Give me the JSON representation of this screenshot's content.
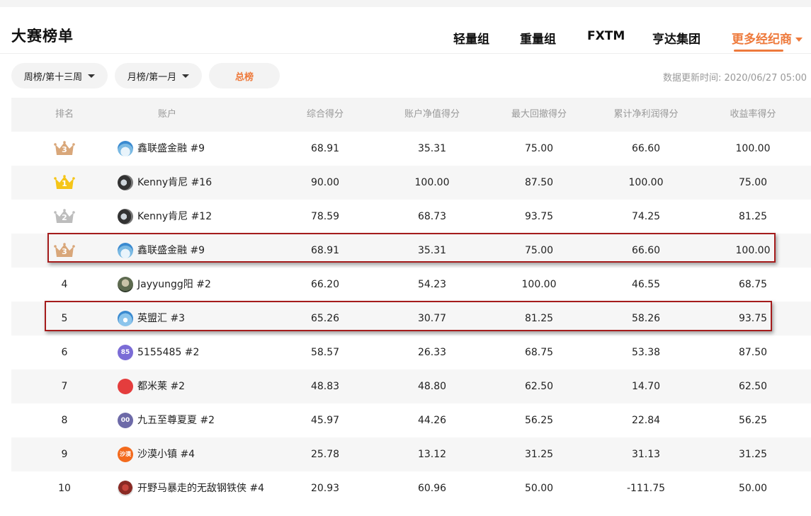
{
  "header": {
    "title": "大赛榜单",
    "tabs": [
      {
        "label": "轻量组",
        "active": false
      },
      {
        "label": "重量组",
        "active": false
      },
      {
        "label": "FXTM",
        "active": false
      },
      {
        "label": "亨达集团",
        "active": false
      },
      {
        "label": "更多经纪商",
        "active": true
      }
    ]
  },
  "filters": {
    "week": "周榜/第十三周",
    "month": "月榜/第一月",
    "total": "总榜",
    "update_time": "数据更新时间: 2020/06/27 05:00"
  },
  "table": {
    "columns": [
      "排名",
      "账户",
      "综合得分",
      "账户净值得分",
      "最大回撤得分",
      "累计净利润得分",
      "收益率得分"
    ],
    "rows": [
      {
        "rank": "3",
        "rank_style": "crown-bronze",
        "avatar": "sky",
        "avatar_text": "",
        "account": "鑫联盛金融 #9",
        "s1": "68.91",
        "s2": "35.31",
        "s3": "75.00",
        "s4": "66.60",
        "s5": "100.00"
      },
      {
        "rank": "1",
        "rank_style": "crown-gold",
        "avatar": "dark",
        "avatar_text": "",
        "account": "Kenny肯尼 #16",
        "s1": "90.00",
        "s2": "100.00",
        "s3": "87.50",
        "s4": "100.00",
        "s5": "75.00"
      },
      {
        "rank": "2",
        "rank_style": "crown-silver",
        "avatar": "dark",
        "avatar_text": "",
        "account": "Kenny肯尼 #12",
        "s1": "78.59",
        "s2": "68.73",
        "s3": "93.75",
        "s4": "74.25",
        "s5": "81.25"
      },
      {
        "rank": "3",
        "rank_style": "crown-bronze",
        "avatar": "sky",
        "avatar_text": "",
        "account": "鑫联盛金融 #9",
        "s1": "68.91",
        "s2": "35.31",
        "s3": "75.00",
        "s4": "66.60",
        "s5": "100.00"
      },
      {
        "rank": "4",
        "rank_style": "text",
        "avatar": "photo",
        "avatar_text": "",
        "account": "Jayyungg阳 #2",
        "s1": "66.20",
        "s2": "54.23",
        "s3": "100.00",
        "s4": "46.55",
        "s5": "68.75"
      },
      {
        "rank": "5",
        "rank_style": "text",
        "avatar": "blue",
        "avatar_text": "",
        "account": "英盟汇 #3",
        "s1": "65.26",
        "s2": "30.77",
        "s3": "81.25",
        "s4": "58.26",
        "s5": "93.75"
      },
      {
        "rank": "6",
        "rank_style": "text",
        "avatar": "purple",
        "avatar_text": "85",
        "account": "5155485 #2",
        "s1": "58.57",
        "s2": "26.33",
        "s3": "68.75",
        "s4": "53.38",
        "s5": "87.50"
      },
      {
        "rank": "7",
        "rank_style": "text",
        "avatar": "red",
        "avatar_text": "",
        "account": "都米莱 #2",
        "s1": "48.83",
        "s2": "48.80",
        "s3": "62.50",
        "s4": "14.70",
        "s5": "62.50"
      },
      {
        "rank": "8",
        "rank_style": "text",
        "avatar": "indigo",
        "avatar_text": "00",
        "account": "九五至尊夏夏 #2",
        "s1": "45.97",
        "s2": "44.26",
        "s3": "56.25",
        "s4": "22.84",
        "s5": "56.25"
      },
      {
        "rank": "9",
        "rank_style": "text",
        "avatar": "orange",
        "avatar_text": "沙漠",
        "account": "沙漠小镇 #4",
        "s1": "25.78",
        "s2": "13.12",
        "s3": "31.25",
        "s4": "31.13",
        "s5": "31.25"
      },
      {
        "rank": "10",
        "rank_style": "text",
        "avatar": "person",
        "avatar_text": "",
        "account": "开野马暴走的无敌钢铁侠 #4",
        "s1": "20.93",
        "s2": "60.96",
        "s3": "50.00",
        "s4": "-111.75",
        "s5": "50.00"
      }
    ]
  },
  "highlighted_rows": [
    3,
    5
  ],
  "colors": {
    "accent": "#ee7a3c",
    "highlight_border": "#a51c1c",
    "crown_gold": "#f5c518",
    "crown_silver": "#bdbdbd",
    "crown_bronze": "#d9a77a"
  }
}
